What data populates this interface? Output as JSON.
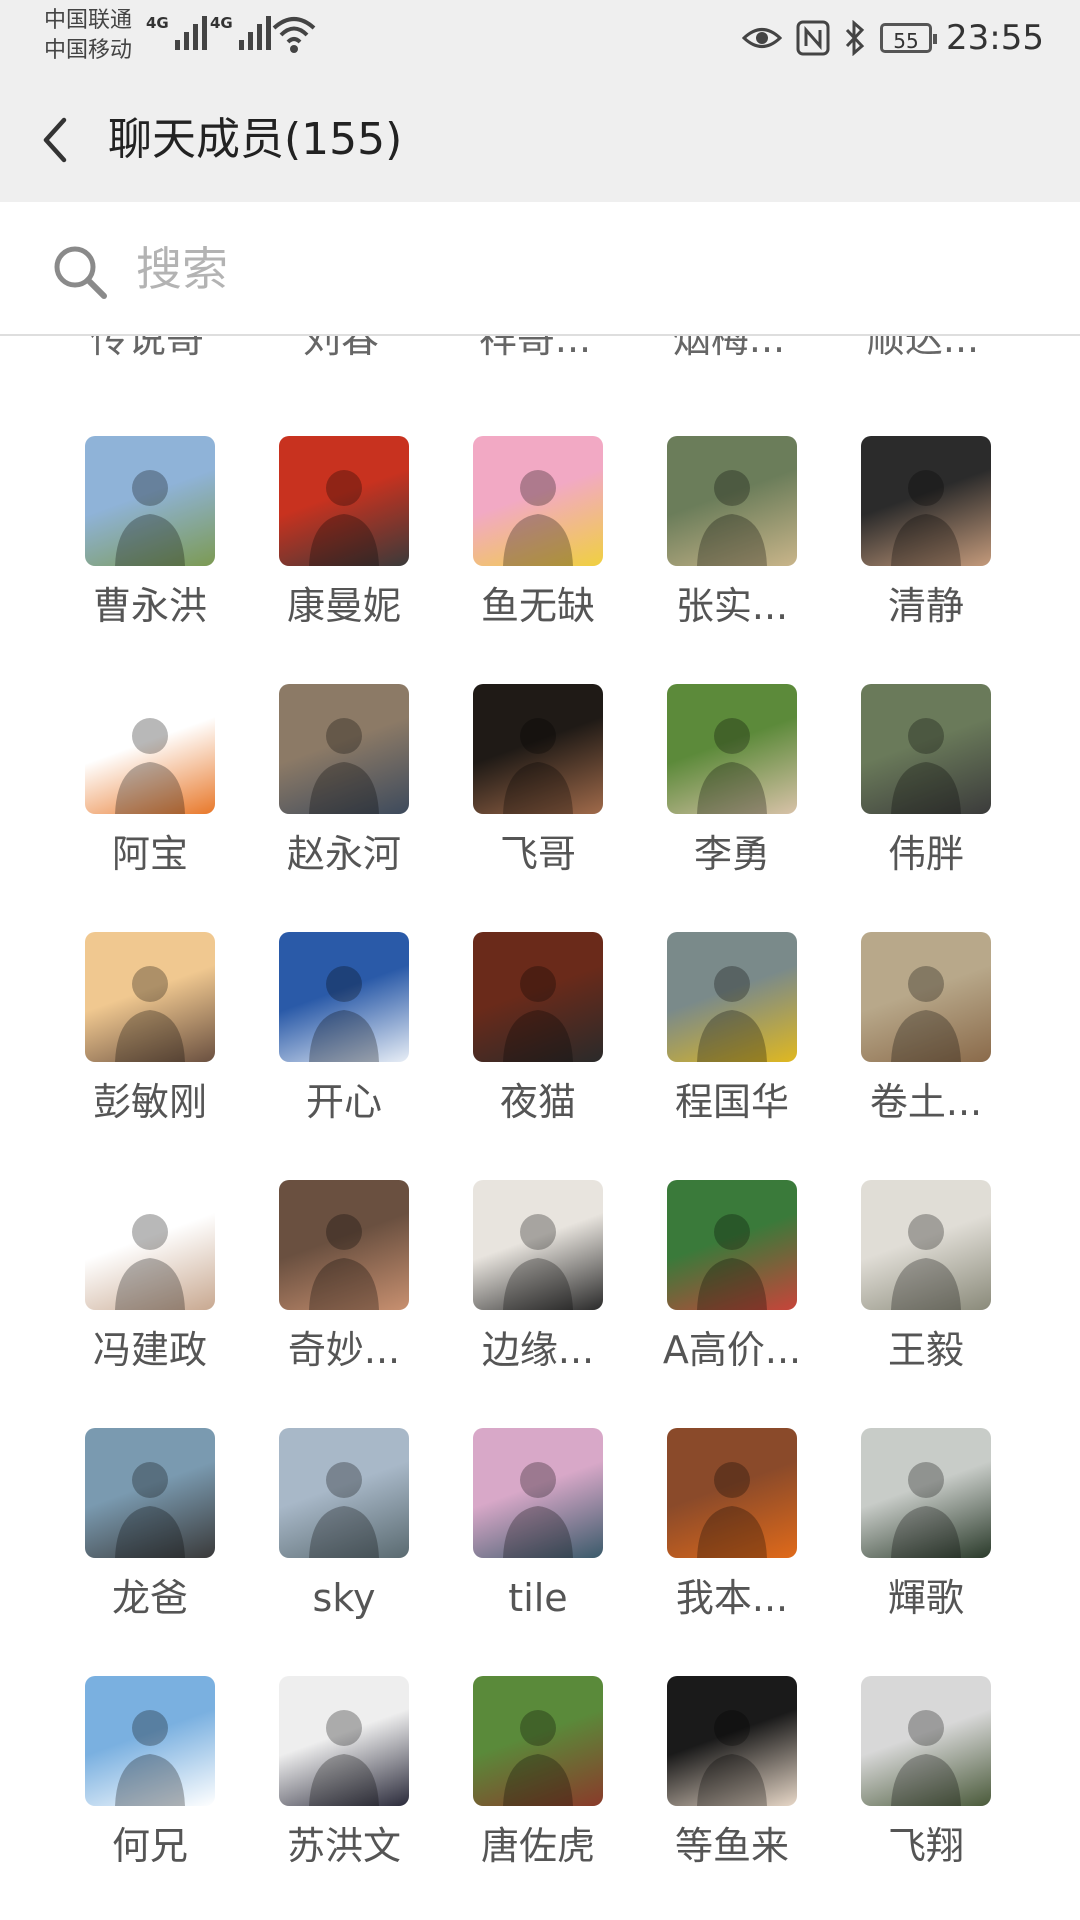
{
  "status_bar": {
    "carrier_1": "中国联通",
    "carrier_2": "中国移动",
    "net_1": "4G",
    "net_2": "4G",
    "battery": "55",
    "time": "23:55"
  },
  "header": {
    "title": "聊天成员(155)"
  },
  "search": {
    "placeholder": "搜索"
  },
  "partial_row": [
    "传说哥",
    "刘春",
    "祥哥...",
    "烟梅...",
    "顺达..."
  ],
  "members": [
    {
      "name": "曹永洪",
      "colors": [
        "#8fb3d8",
        "#7c9a52"
      ]
    },
    {
      "name": "康曼妮",
      "colors": [
        "#c8321f",
        "#3a3a3a"
      ]
    },
    {
      "name": "鱼无缺",
      "colors": [
        "#f2a9c4",
        "#f0d040"
      ]
    },
    {
      "name": "张实...",
      "colors": [
        "#6b7d5a",
        "#c9b58a"
      ]
    },
    {
      "name": "清静",
      "colors": [
        "#2b2b2b",
        "#c49a7b"
      ]
    },
    {
      "name": "阿宝",
      "colors": [
        "#ffffff",
        "#e8782a"
      ]
    },
    {
      "name": "赵永河",
      "colors": [
        "#8c7a66",
        "#3d4a5c"
      ]
    },
    {
      "name": "飞哥",
      "colors": [
        "#1f1a16",
        "#a06a4a"
      ]
    },
    {
      "name": "李勇",
      "colors": [
        "#5c8a3a",
        "#d8c2a8"
      ]
    },
    {
      "name": "伟胖",
      "colors": [
        "#6a7a5a",
        "#3b3b3b"
      ]
    },
    {
      "name": "彭敏刚",
      "colors": [
        "#f0c890",
        "#6a5040"
      ]
    },
    {
      "name": "开心",
      "colors": [
        "#2a5aa8",
        "#e8eef6"
      ]
    },
    {
      "name": "夜猫",
      "colors": [
        "#6a2a1a",
        "#2a2a2a"
      ]
    },
    {
      "name": "程国华",
      "colors": [
        "#7a8a8a",
        "#e0b820"
      ]
    },
    {
      "name": "卷土...",
      "colors": [
        "#b8a88a",
        "#8a6a4a"
      ]
    },
    {
      "name": "冯建政",
      "colors": [
        "#ffffff",
        "#c8a890"
      ]
    },
    {
      "name": "奇妙...",
      "colors": [
        "#6a5040",
        "#c89070"
      ]
    },
    {
      "name": "边缘...",
      "colors": [
        "#e8e4de",
        "#2a2a2a"
      ]
    },
    {
      "name": "A高价...",
      "colors": [
        "#3a7a3a",
        "#c8443a"
      ]
    },
    {
      "name": "王毅",
      "colors": [
        "#e0ddd6",
        "#8a8a7a"
      ]
    },
    {
      "name": "龙爸",
      "colors": [
        "#7a9ab0",
        "#3a3a3a"
      ]
    },
    {
      "name": "sky",
      "colors": [
        "#a8b8c8",
        "#5a6a70"
      ]
    },
    {
      "name": "tile",
      "colors": [
        "#d8a8c8",
        "#3a5a6a"
      ]
    },
    {
      "name": "我本...",
      "colors": [
        "#8a4a2a",
        "#e06a1a"
      ]
    },
    {
      "name": "輝歌",
      "colors": [
        "#c8ccc8",
        "#2a3a2a"
      ]
    },
    {
      "name": "何兄",
      "colors": [
        "#7ab0e0",
        "#ffffff"
      ]
    },
    {
      "name": "苏洪文",
      "colors": [
        "#eeeeee",
        "#2a2a3a"
      ]
    },
    {
      "name": "唐佐虎",
      "colors": [
        "#5a8a3a",
        "#8a3a2a"
      ]
    },
    {
      "name": "等鱼来",
      "colors": [
        "#1a1a1a",
        "#e8d8c8"
      ]
    },
    {
      "name": "飞翔",
      "colors": [
        "#d8d8d8",
        "#4a5a3a"
      ]
    }
  ]
}
